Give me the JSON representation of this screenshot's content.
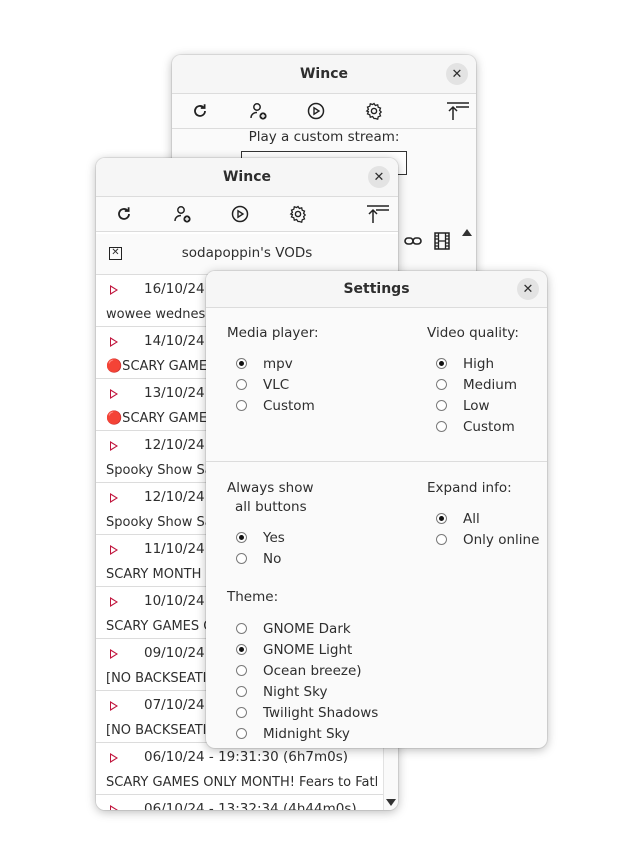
{
  "back_window": {
    "title": "Wince",
    "close_glyph": "✕",
    "custom_stream_label": "Play a custom stream:",
    "custom_stream_value": "",
    "icons": [
      "refresh-icon",
      "add-user-icon",
      "play-circle-icon",
      "gear-icon",
      "scroll-to-top-icon",
      "link-icon",
      "film-icon"
    ]
  },
  "main_window": {
    "title": "Wince",
    "close_glyph": "✕",
    "icons": [
      "refresh-icon",
      "add-user-icon",
      "play-circle-icon",
      "gear-icon",
      "scroll-to-top-icon"
    ],
    "vod_header": {
      "close_glyph": "✕",
      "title": "sodapoppin's VODs"
    },
    "vods": [
      {
        "date": "16/10/24 -",
        "title": "wowee wednesd"
      },
      {
        "date": "14/10/24 -",
        "title": "🔴SCARY GAMES"
      },
      {
        "date": "13/10/24 -",
        "title": "🔴SCARY GAMES"
      },
      {
        "date": "12/10/24 -",
        "title": "Spooky Show Sa"
      },
      {
        "date": "12/10/24 -",
        "title": "Spooky Show Sa"
      },
      {
        "date": "11/10/24 -",
        "title": "SCARY MONTH G"
      },
      {
        "date": "10/10/24 -",
        "title": "SCARY GAMES O"
      },
      {
        "date": "09/10/24 -",
        "title": "[NO BACKSEATIN"
      },
      {
        "date": "07/10/24 -",
        "title": "[NO BACKSEATIN"
      },
      {
        "date": "06/10/24 - 19:31:30 (6h7m0s)",
        "title": "SCARY GAMES ONLY MONTH! Fears to Fatl"
      },
      {
        "date": "06/10/24 - 13:32:34 (4h44m0s)",
        "title": ""
      }
    ]
  },
  "settings": {
    "title": "Settings",
    "close_glyph": "✕",
    "media_player": {
      "label": "Media player:",
      "options": [
        "mpv",
        "VLC",
        "Custom"
      ],
      "selected": "mpv"
    },
    "video_quality": {
      "label": "Video quality:",
      "options": [
        "High",
        "Medium",
        "Low",
        "Custom"
      ],
      "selected": "High"
    },
    "always_show": {
      "label_line1": "Always show",
      "label_line2": "all buttons",
      "options": [
        "Yes",
        "No"
      ],
      "selected": "Yes"
    },
    "expand_info": {
      "label": "Expand info:",
      "options": [
        "All",
        "Only online"
      ],
      "selected": "All"
    },
    "theme": {
      "label": "Theme:",
      "options": [
        "GNOME Dark",
        "GNOME Light",
        "Ocean breeze)",
        "Night Sky",
        "Twilight Shadows",
        "Midnight Sky"
      ],
      "selected": "GNOME Light"
    }
  }
}
